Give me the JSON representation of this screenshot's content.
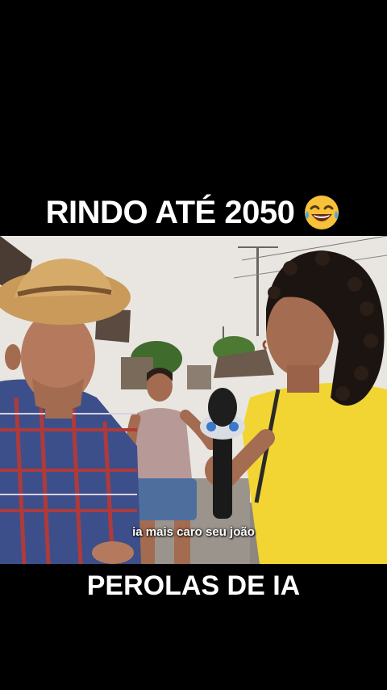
{
  "top_caption": {
    "text": "RINDO ATÉ 2050",
    "emoji": "laughing-tears-emoji"
  },
  "video": {
    "subtitle": "ia mais caro seu joão",
    "scene_description_icon": "street-interview-scene"
  },
  "bottom_caption": {
    "text": "PEROLAS DE IA"
  },
  "colors": {
    "background": "#000000",
    "caption_text": "#ffffff",
    "emoji_yellow": "#f7c23a",
    "shirt_yellow": "#f2d532"
  }
}
